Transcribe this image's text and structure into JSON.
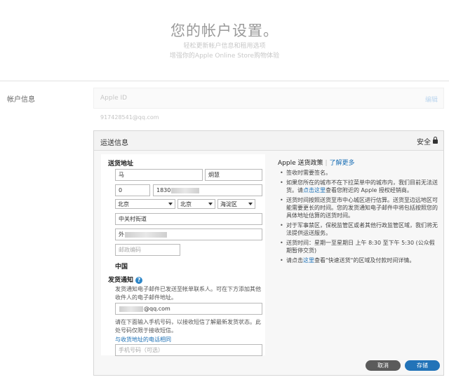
{
  "hero": {
    "title": "您的帐户设置。",
    "subtitle_line1": "轻松更新帐户信息和租用选项",
    "subtitle_line2": "增强你的Apple Online Store购物体验"
  },
  "account": {
    "section_label": "帐户信息",
    "apple_id_label": "Apple ID",
    "edit_label": "编辑",
    "email": "917428541@qq.com"
  },
  "shipping": {
    "card_title": "运送信息",
    "secure_label": "安全",
    "address_heading": "送货地址",
    "last_name": "马",
    "first_name": "炯慧",
    "area_code": "0",
    "phone_prefix": "1830",
    "province": "北京",
    "city": "北京",
    "district": "海淀区",
    "street": "中关村街道",
    "address2_prefix": "外",
    "postal_placeholder": "邮政编码",
    "country": "中国",
    "notify_heading": "发货通知",
    "help_icon": "question-icon",
    "notify_text": "发货通知电子邮件已发送至帐单联系人。可在下方添加其他收件人的电子邮件地址。",
    "notify_email_suffix": "@qq.com",
    "sms_text": "请在下面输入手机号码，以接收短信了解最新发货状态。此处号码仅限于接收短信。",
    "same_as_link": "与收货地址的电话相同",
    "mobile_placeholder": "手机号码（可选）"
  },
  "policy": {
    "title": "Apple 送货政策",
    "learn_more": "了解更多",
    "items": [
      {
        "text": "签收时需要签名。"
      },
      {
        "pre": "如果您所在的城市不在下拉菜单中的城市内，我们目前无法送货。请",
        "link": "点击这里",
        "post": "查看您附近的 Apple 授权经销商。"
      },
      {
        "text": "送货时间按照送货至市中心城区进行估算。送货至边远地区可能需要更长的时间。您的发货通知电子邮件中将包括按照您的具体地址估算的送货时间。"
      },
      {
        "text": "对于军事禁区，保税监管区或者其他行政监管区域，我们将无法提供运送服务。"
      },
      {
        "text": "送货时间：星期一至星期日 上午 8:30 至下午 5:30 (公众假期暂停交货)"
      },
      {
        "pre": "请点击",
        "link": "这里",
        "post": "查看\"快速送货\"的区域及付款时间详情。"
      }
    ]
  },
  "buttons": {
    "cancel": "取消",
    "save": "存储"
  },
  "colors": {
    "accent": "#2273b8",
    "link": "#1a6fb5",
    "cancel": "#5b5b5b"
  }
}
